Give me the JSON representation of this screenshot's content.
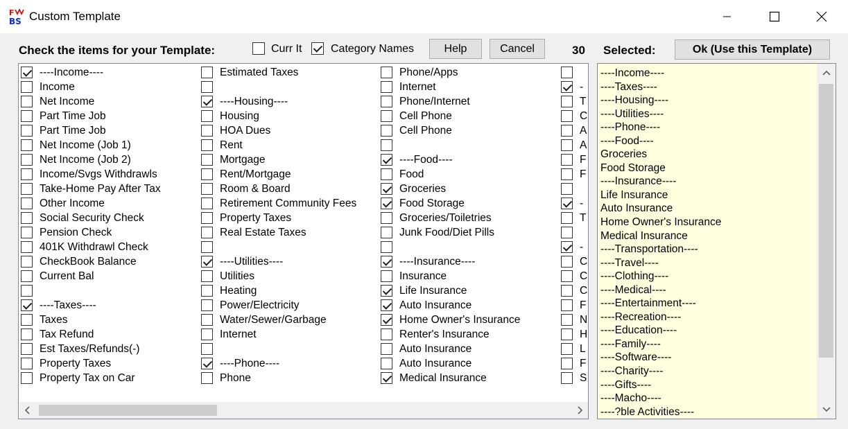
{
  "window": {
    "title": "Custom Template",
    "logo_top": "F",
    "logo_bottom": "BS"
  },
  "toolbar": {
    "instruction": "Check the items for your Template:",
    "curr_it_label": "Curr It",
    "curr_it_checked": false,
    "category_names_label": "Category Names",
    "category_names_checked": true,
    "help_label": "Help",
    "cancel_label": "Cancel",
    "count": "30",
    "selected_label": "Selected:",
    "ok_label": "Ok (Use this Template)"
  },
  "columns": [
    {
      "items": [
        {
          "label": "----Income----",
          "checked": true
        },
        {
          "label": "Income",
          "checked": false
        },
        {
          "label": "Net Income",
          "checked": false
        },
        {
          "label": "Part Time Job",
          "checked": false
        },
        {
          "label": "Part Time Job",
          "checked": false
        },
        {
          "label": "Net Income (Job 1)",
          "checked": false
        },
        {
          "label": "Net Income (Job 2)",
          "checked": false
        },
        {
          "label": "Income/Svgs Withdrawls",
          "checked": false
        },
        {
          "label": "Take-Home Pay After Tax",
          "checked": false
        },
        {
          "label": "Other Income",
          "checked": false
        },
        {
          "label": "Social Security Check",
          "checked": false
        },
        {
          "label": "Pension Check",
          "checked": false
        },
        {
          "label": "401K Withdrawl Check",
          "checked": false
        },
        {
          "label": "CheckBook Balance",
          "checked": false
        },
        {
          "label": "Current Bal",
          "checked": false
        },
        {
          "label": "",
          "checked": false
        },
        {
          "label": "----Taxes----",
          "checked": true
        },
        {
          "label": "Taxes",
          "checked": false
        },
        {
          "label": "Tax Refund",
          "checked": false
        },
        {
          "label": "Est Taxes/Refunds(-)",
          "checked": false
        },
        {
          "label": "Property Taxes",
          "checked": false
        },
        {
          "label": "Property Tax on Car",
          "checked": false
        }
      ]
    },
    {
      "items": [
        {
          "label": "Estimated Taxes",
          "checked": false
        },
        {
          "label": "",
          "checked": false
        },
        {
          "label": "----Housing----",
          "checked": true
        },
        {
          "label": "Housing",
          "checked": false
        },
        {
          "label": "HOA Dues",
          "checked": false
        },
        {
          "label": "Rent",
          "checked": false
        },
        {
          "label": "Mortgage",
          "checked": false
        },
        {
          "label": "Rent/Mortgage",
          "checked": false
        },
        {
          "label": "Room & Board",
          "checked": false
        },
        {
          "label": "Retirement Community Fees",
          "checked": false
        },
        {
          "label": "Property Taxes",
          "checked": false
        },
        {
          "label": "Real Estate Taxes",
          "checked": false
        },
        {
          "label": "",
          "checked": false
        },
        {
          "label": "----Utilities----",
          "checked": true
        },
        {
          "label": "Utilities",
          "checked": false
        },
        {
          "label": "Heating",
          "checked": false
        },
        {
          "label": "Power/Electricity",
          "checked": false
        },
        {
          "label": "Water/Sewer/Garbage",
          "checked": false
        },
        {
          "label": "Internet",
          "checked": false
        },
        {
          "label": "",
          "checked": false
        },
        {
          "label": "----Phone----",
          "checked": true
        },
        {
          "label": "Phone",
          "checked": false
        }
      ]
    },
    {
      "items": [
        {
          "label": "Phone/Apps",
          "checked": false
        },
        {
          "label": "Internet",
          "checked": false
        },
        {
          "label": "Phone/Internet",
          "checked": false
        },
        {
          "label": "Cell Phone",
          "checked": false
        },
        {
          "label": "Cell Phone",
          "checked": false
        },
        {
          "label": "",
          "checked": false
        },
        {
          "label": "----Food----",
          "checked": true
        },
        {
          "label": "Food",
          "checked": false
        },
        {
          "label": "Groceries",
          "checked": true
        },
        {
          "label": "Food Storage",
          "checked": true
        },
        {
          "label": "Groceries/Toiletries",
          "checked": false
        },
        {
          "label": "Junk Food/Diet Pills",
          "checked": false
        },
        {
          "label": "",
          "checked": false
        },
        {
          "label": "----Insurance----",
          "checked": true
        },
        {
          "label": "Insurance",
          "checked": false
        },
        {
          "label": "Life Insurance",
          "checked": true
        },
        {
          "label": "Auto Insurance",
          "checked": true
        },
        {
          "label": "Home Owner's Insurance",
          "checked": true
        },
        {
          "label": "Renter's Insurance",
          "checked": false
        },
        {
          "label": "Auto Insurance",
          "checked": false
        },
        {
          "label": "Auto Insurance",
          "checked": false
        },
        {
          "label": "Medical Insurance",
          "checked": true
        }
      ]
    },
    {
      "items": [
        {
          "label": "",
          "checked": false
        },
        {
          "label": "-",
          "checked": true
        },
        {
          "label": "T",
          "checked": false
        },
        {
          "label": "C",
          "checked": false
        },
        {
          "label": "A",
          "checked": false
        },
        {
          "label": "A",
          "checked": false
        },
        {
          "label": "F",
          "checked": false
        },
        {
          "label": "F",
          "checked": false
        },
        {
          "label": "",
          "checked": false
        },
        {
          "label": "-",
          "checked": true
        },
        {
          "label": "T",
          "checked": false
        },
        {
          "label": "",
          "checked": false
        },
        {
          "label": "-",
          "checked": true
        },
        {
          "label": "C",
          "checked": false
        },
        {
          "label": "C",
          "checked": false
        },
        {
          "label": "C",
          "checked": false
        },
        {
          "label": "F",
          "checked": false
        },
        {
          "label": "N",
          "checked": false
        },
        {
          "label": "H",
          "checked": false
        },
        {
          "label": "L",
          "checked": false
        },
        {
          "label": "F",
          "checked": false
        },
        {
          "label": "S",
          "checked": false
        }
      ]
    }
  ],
  "selected_items": [
    "----Income----",
    "----Taxes----",
    "----Housing----",
    "----Utilities----",
    "----Phone----",
    "----Food----",
    "Groceries",
    "Food Storage",
    "----Insurance----",
    "Life Insurance",
    "Auto Insurance",
    "Home Owner's Insurance",
    "Medical Insurance",
    "----Transportation----",
    "----Travel----",
    "----Clothing----",
    "----Medical----",
    "----Entertainment----",
    "----Recreation----",
    "----Education----",
    "----Family----",
    "----Software----",
    "----Charity----",
    "----Gifts----",
    "----Macho----",
    "----?ble Activities----"
  ],
  "icons": {
    "minimize": "minimize-icon",
    "maximize": "maximize-icon",
    "close": "close-icon",
    "scroll_left": "chevron-left-icon",
    "scroll_right": "chevron-right-icon",
    "scroll_up": "chevron-up-icon",
    "scroll_down": "chevron-down-icon"
  }
}
